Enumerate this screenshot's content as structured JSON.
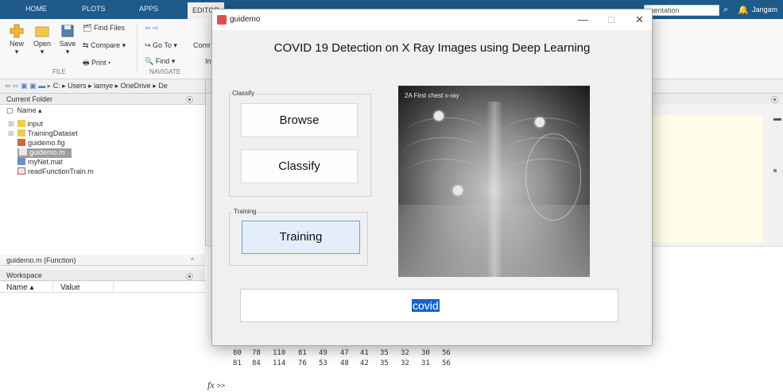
{
  "matlab": {
    "tabs": [
      "HOME",
      "PLOTS",
      "APPS",
      "EDITOR"
    ],
    "search_placeholder": "mentation",
    "user": "Jangam",
    "ribbon": {
      "new": "New",
      "open": "Open",
      "save": "Save",
      "find_files": "Find Files",
      "compare": "Compare ▾",
      "print": "Print ▾",
      "go_to": "Go To ▾",
      "find": "Find ▾",
      "comment": "Comr",
      "indent": "In",
      "group_file": "FILE",
      "group_navigate": "NAVIGATE"
    },
    "address": "C: ▸ Users ▸ iamye ▸ OneDrive ▸ De",
    "current_folder": {
      "title": "Current Folder",
      "column": "Name ▴",
      "items": [
        "input",
        "TrainingDataset",
        "guidemo.fig",
        "guidemo.m",
        "myNet.mat",
        "readFunctionTrain.m"
      ]
    },
    "details": "guidemo.m  (Function)",
    "workspace": {
      "title": "Workspace",
      "col_name": "Name ▴",
      "col_value": "Value"
    },
    "command_rows": [
      [
        "80",
        "78",
        "110",
        "81",
        "49",
        "47",
        "41",
        "35",
        "32",
        "30",
        "56"
      ],
      [
        "81",
        "84",
        "114",
        "76",
        "53",
        "48",
        "42",
        "35",
        "32",
        "31",
        "56"
      ]
    ],
    "prompt_fx": "fx",
    "prompt": ">>"
  },
  "guidemo": {
    "window_title": "guidemo",
    "heading": "COVID 19 Detection on X Ray Images using Deep Learning",
    "classify_panel": "Classify",
    "browse_button": "Browse",
    "classify_button": "Classify",
    "training_panel": "Training",
    "training_button": "Training",
    "xray_caption": "2A First chest x-ray",
    "result": "covid"
  }
}
